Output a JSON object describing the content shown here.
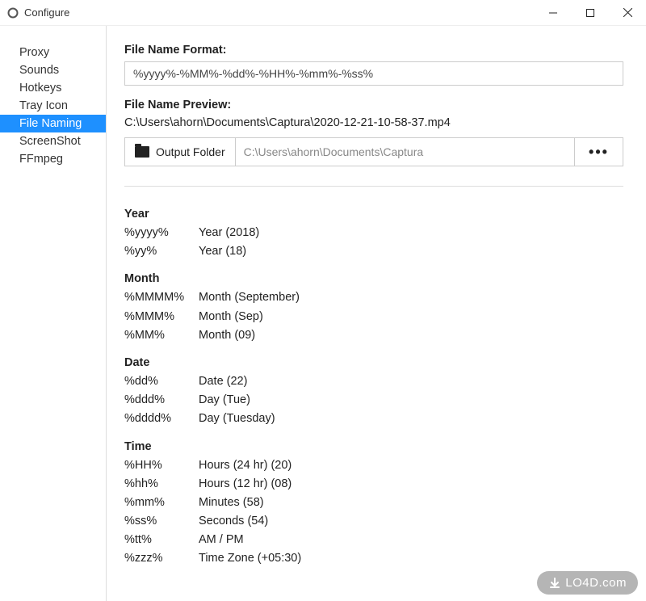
{
  "window": {
    "title": "Configure"
  },
  "sidebar": {
    "items": [
      {
        "label": "Proxy"
      },
      {
        "label": "Sounds"
      },
      {
        "label": "Hotkeys"
      },
      {
        "label": "Tray Icon"
      },
      {
        "label": "File Naming",
        "selected": true
      },
      {
        "label": "ScreenShot"
      },
      {
        "label": "FFmpeg"
      }
    ]
  },
  "main": {
    "format_label": "File Name Format:",
    "format_value": "%yyyy%-%MM%-%dd%-%HH%-%mm%-%ss%",
    "preview_label": "File Name Preview:",
    "preview_value": "C:\\Users\\ahorn\\Documents\\Captura\\2020-12-21-10-58-37.mp4",
    "output_folder_label": "Output Folder",
    "output_folder_path": "C:\\Users\\ahorn\\Documents\\Captura",
    "more_button": "•••"
  },
  "reference": [
    {
      "title": "Year",
      "rows": [
        {
          "token": "%yyyy%",
          "desc": "Year (2018)"
        },
        {
          "token": "%yy%",
          "desc": "Year (18)"
        }
      ]
    },
    {
      "title": "Month",
      "rows": [
        {
          "token": "%MMMM%",
          "desc": "Month (September)"
        },
        {
          "token": "%MMM%",
          "desc": "Month (Sep)"
        },
        {
          "token": "%MM%",
          "desc": "Month (09)"
        }
      ]
    },
    {
      "title": "Date",
      "rows": [
        {
          "token": "%dd%",
          "desc": "Date (22)"
        },
        {
          "token": "%ddd%",
          "desc": "Day (Tue)"
        },
        {
          "token": "%dddd%",
          "desc": "Day (Tuesday)"
        }
      ]
    },
    {
      "title": "Time",
      "rows": [
        {
          "token": "%HH%",
          "desc": "Hours (24 hr) (20)"
        },
        {
          "token": "%hh%",
          "desc": "Hours (12 hr) (08)"
        },
        {
          "token": "%mm%",
          "desc": "Minutes (58)"
        },
        {
          "token": "%ss%",
          "desc": "Seconds (54)"
        },
        {
          "token": "%tt%",
          "desc": "AM / PM"
        },
        {
          "token": "%zzz%",
          "desc": "Time Zone (+05:30)"
        }
      ]
    }
  ],
  "watermark": "LO4D.com"
}
